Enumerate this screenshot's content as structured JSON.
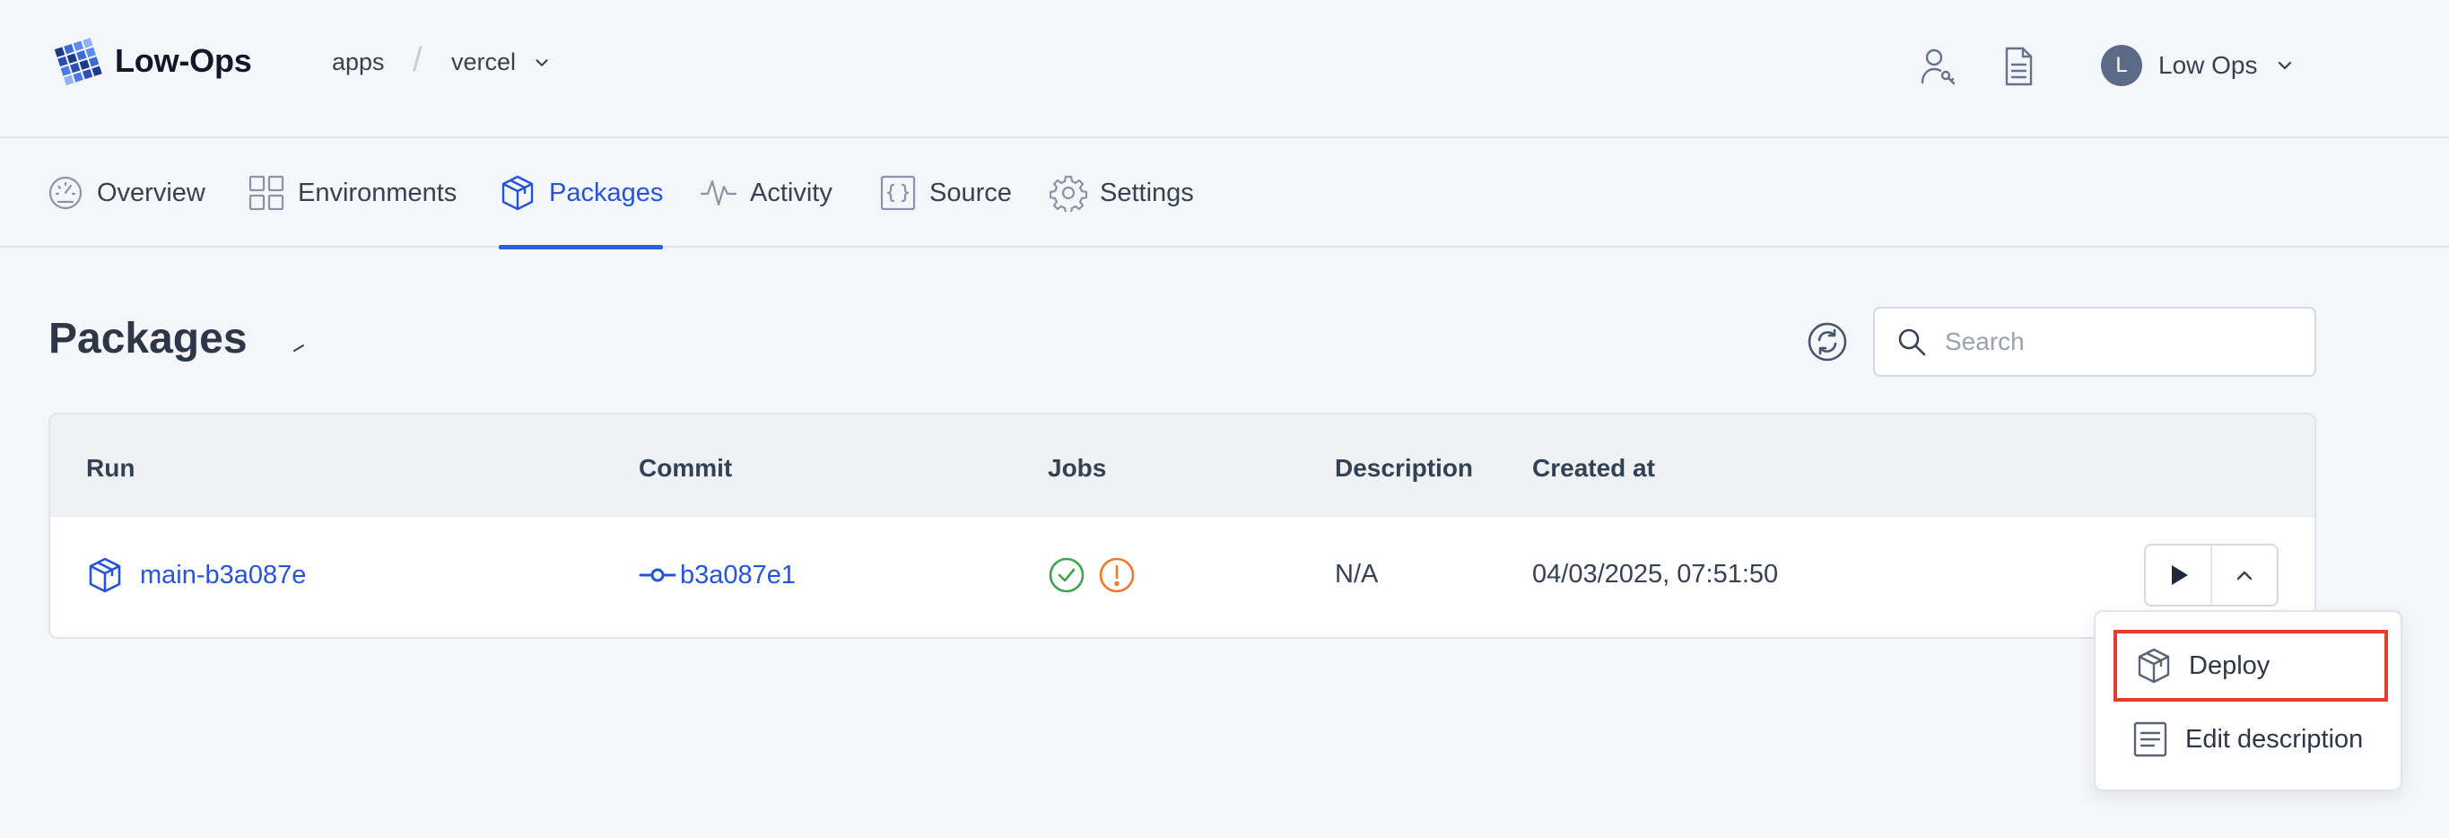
{
  "brand": {
    "name": "Low-Ops"
  },
  "breadcrumb": {
    "org": "apps",
    "separator": "/",
    "project": "vercel"
  },
  "header": {
    "user_initial": "L",
    "user_name": "Low Ops",
    "icons": [
      "user-key-icon",
      "document-icon"
    ]
  },
  "tabs": [
    {
      "label": "Overview",
      "icon": "gauge-icon",
      "active": false
    },
    {
      "label": "Environments",
      "icon": "grid-icon",
      "active": false
    },
    {
      "label": "Packages",
      "icon": "package-icon",
      "active": true
    },
    {
      "label": "Activity",
      "icon": "activity-icon",
      "active": false
    },
    {
      "label": "Source",
      "icon": "code-braces-icon",
      "active": false
    },
    {
      "label": "Settings",
      "icon": "gear-icon",
      "active": false
    }
  ],
  "page": {
    "title": "Packages",
    "search_placeholder": "Search"
  },
  "table": {
    "columns": [
      "Run",
      "Commit",
      "Jobs",
      "Description",
      "Created at"
    ],
    "rows": [
      {
        "run": "main-b3a087e",
        "commit": "b3a087e1",
        "jobs": [
          "success",
          "warning"
        ],
        "description": "N/A",
        "created_at": "04/03/2025, 07:51:50"
      }
    ]
  },
  "menu": {
    "items": [
      {
        "label": "Deploy",
        "icon": "package-icon",
        "highlighted": true
      },
      {
        "label": "Edit description",
        "icon": "document-lines-icon",
        "highlighted": false
      }
    ]
  },
  "colors": {
    "accent": "#2753d8",
    "success": "#3fa34d",
    "warning": "#f0782a",
    "highlight_border": "#e0412d",
    "avatar": "#5b6a87"
  }
}
